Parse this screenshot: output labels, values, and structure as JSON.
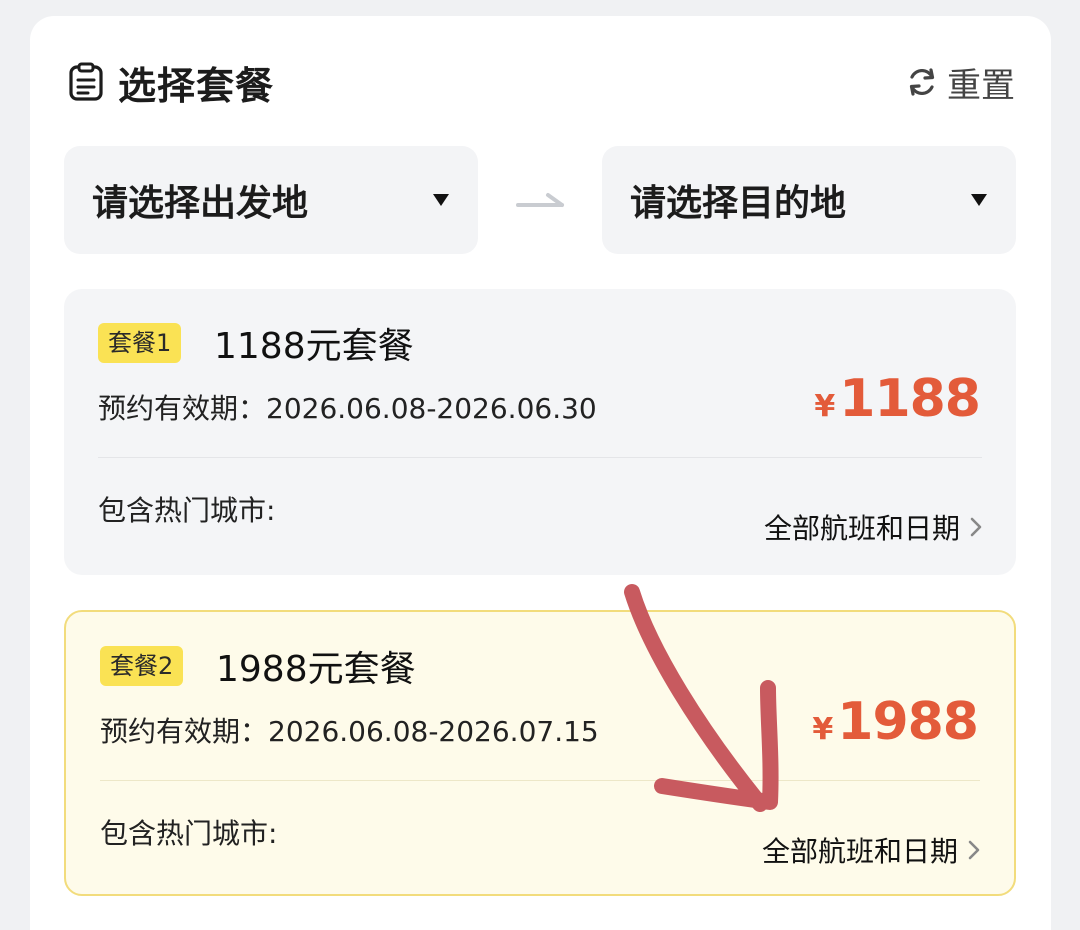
{
  "header": {
    "title": "选择套餐",
    "reset_label": "重置"
  },
  "route": {
    "origin_placeholder": "请选择出发地",
    "destination_placeholder": "请选择目的地"
  },
  "packages": [
    {
      "badge": "套餐1",
      "name": "1188元套餐",
      "validity": "预约有效期：2026.06.08-2026.06.30",
      "currency": "¥",
      "price": "1188",
      "cities_label": "包含热门城市:",
      "link_label": "全部航班和日期",
      "selected": false
    },
    {
      "badge": "套餐2",
      "name": "1988元套餐",
      "validity": "预约有效期：2026.06.08-2026.07.15",
      "currency": "¥",
      "price": "1988",
      "cities_label": "包含热门城市:",
      "link_label": "全部航班和日期",
      "selected": true
    }
  ],
  "colors": {
    "price": "#e35b3a",
    "badge": "#fae254",
    "selected_bg": "#fefbea",
    "selected_border": "#f2dc7c",
    "annotation": "#c85a5f"
  },
  "icons": {
    "title": "document-list-icon",
    "reset": "refresh-icon",
    "select": "caret-down-icon",
    "route": "arrow-right-icon",
    "link": "chevron-right-icon"
  }
}
